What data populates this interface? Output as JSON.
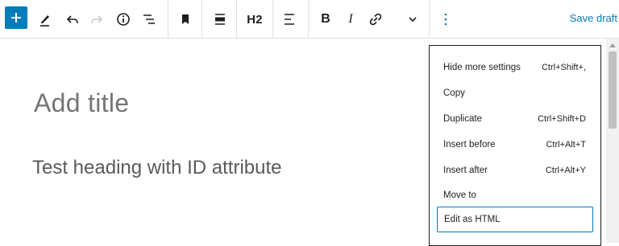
{
  "toolbar": {
    "add_icon": "plus-icon",
    "h2_label": "H2",
    "bold_label": "B",
    "italic_label": "I",
    "save_draft": "Save draft"
  },
  "editor": {
    "title_placeholder": "Add title",
    "heading_text": "Test heading with ID attribute"
  },
  "menu": {
    "items": [
      {
        "label": "Hide more settings",
        "shortcut": "Ctrl+Shift+,"
      },
      {
        "label": "Copy",
        "shortcut": ""
      },
      {
        "label": "Duplicate",
        "shortcut": "Ctrl+Shift+D"
      },
      {
        "label": "Insert before",
        "shortcut": "Ctrl+Alt+T"
      },
      {
        "label": "Insert after",
        "shortcut": "Ctrl+Alt+Y"
      },
      {
        "label": "Move to",
        "shortcut": ""
      },
      {
        "label": "Edit as HTML",
        "shortcut": ""
      }
    ]
  },
  "colors": {
    "accent": "#007cba",
    "text": "#1e1e1e",
    "placeholder": "#757575"
  }
}
